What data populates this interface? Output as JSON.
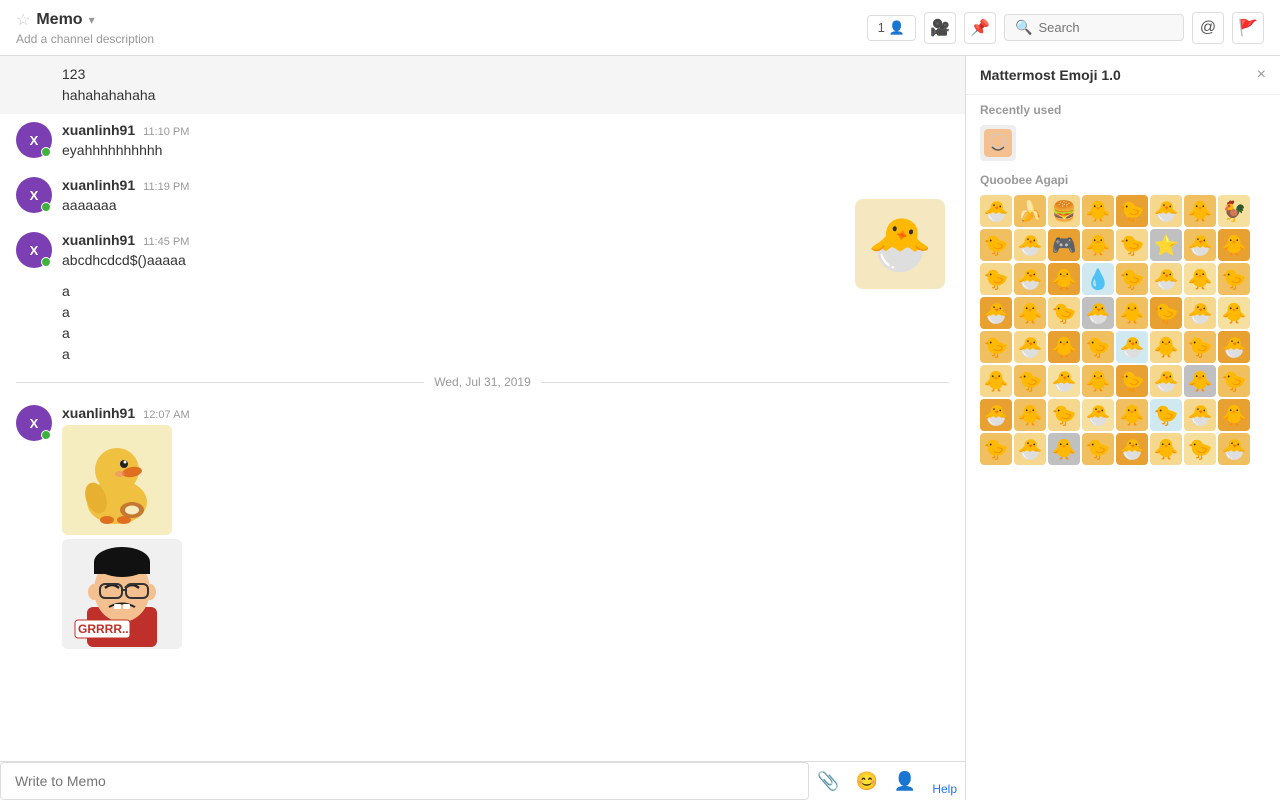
{
  "header": {
    "channel_name": "Memo",
    "channel_desc": "Add a channel description",
    "member_count": "1",
    "search_placeholder": "Search"
  },
  "messages": [
    {
      "id": "msg1",
      "username": "",
      "time": "",
      "texts": [
        "123",
        "hahahahahaha"
      ],
      "highlighted": true,
      "show_avatar": false
    },
    {
      "id": "msg2",
      "username": "xuanlinh91",
      "time": "11:10 PM",
      "texts": [
        "eyahhhhhhhhhh"
      ],
      "highlighted": false,
      "show_avatar": true
    },
    {
      "id": "msg3",
      "username": "xuanlinh91",
      "time": "11:19 PM",
      "texts": [
        "aaaaaaa"
      ],
      "highlighted": false,
      "show_avatar": true
    },
    {
      "id": "msg4",
      "username": "xuanlinh91",
      "time": "11:45 PM",
      "texts": [
        "abcdhcdcd$()aaaaa",
        "a",
        "a",
        "a",
        "a"
      ],
      "highlighted": false,
      "show_avatar": true,
      "has_sticker": true
    }
  ],
  "date_divider": "Wed, Jul 31, 2019",
  "messages_after": [
    {
      "id": "msg5",
      "username": "xuanlinh91",
      "time": "12:07 AM",
      "show_avatar": true,
      "stickers": [
        "duck",
        "grr"
      ]
    }
  ],
  "input": {
    "placeholder": "Write to Memo"
  },
  "emoji_panel": {
    "title": "Mattermost Emoji 1.0",
    "recently_used_label": "Recently used",
    "quoobee_label": "Quoobee Agapi",
    "close_label": "×"
  },
  "footer": {
    "help_label": "Help"
  }
}
